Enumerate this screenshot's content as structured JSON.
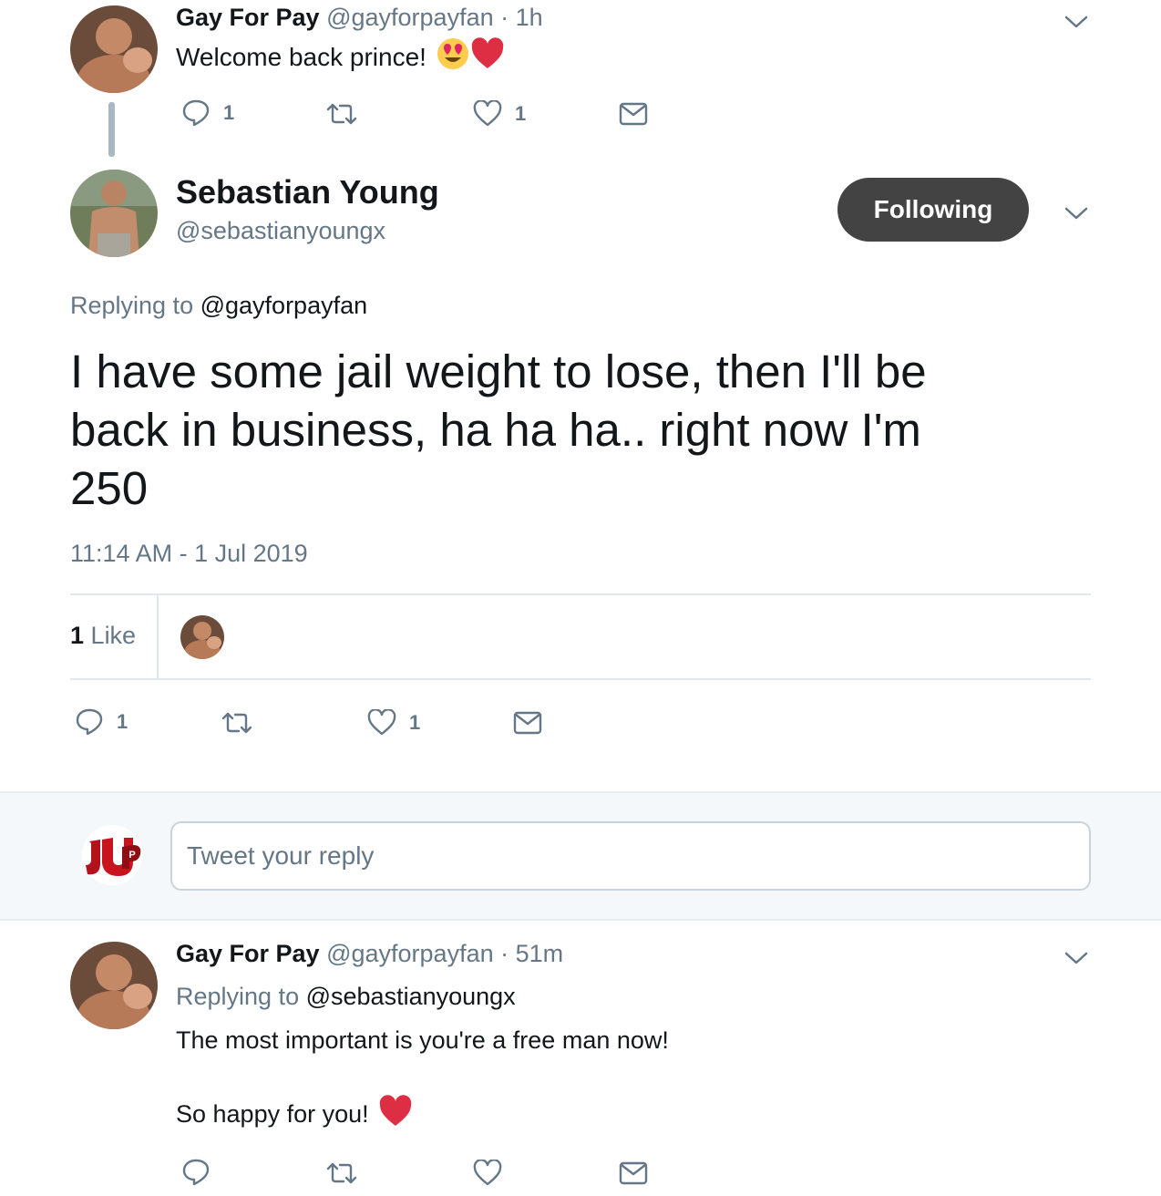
{
  "tweet1": {
    "name": "Gay For Pay",
    "handle": "@gayforpayfan",
    "time": "· 1h",
    "text": "Welcome back prince!",
    "emojis": [
      "heart-eyes-emoji",
      "red-heart-emoji"
    ],
    "reply_count": "1",
    "like_count": "1"
  },
  "main": {
    "name": "Sebastian Young",
    "handle": "@sebastianyoungx",
    "follow_label": "Following",
    "replying_prefix": "Replying to",
    "replying_handle": "@gayforpayfan",
    "text_line1": "I have some jail weight to lose, then I'll be",
    "text_line2": "back in business, ha ha ha.. right now I'm",
    "text_line3": "250",
    "timestamp": "11:14 AM - 1 Jul 2019",
    "likes_num": "1",
    "likes_label": "Like",
    "reply_count": "1",
    "like_count": "1"
  },
  "reply_box": {
    "placeholder": "Tweet your reply"
  },
  "tweet2": {
    "name": "Gay For Pay",
    "handle": "@gayforpayfan",
    "time": "· 51m",
    "replying_prefix": "Replying to",
    "replying_handle": "@sebastianyoungx",
    "text_line1": "The most important is you're a free man now!",
    "text_line2": "So happy for you!",
    "emojis": [
      "red-heart-emoji"
    ]
  },
  "colors": {
    "text": "#14171a",
    "secondary": "#657786",
    "button": "#434343",
    "band": "#f5f8fa",
    "heart": "#e0245e"
  }
}
